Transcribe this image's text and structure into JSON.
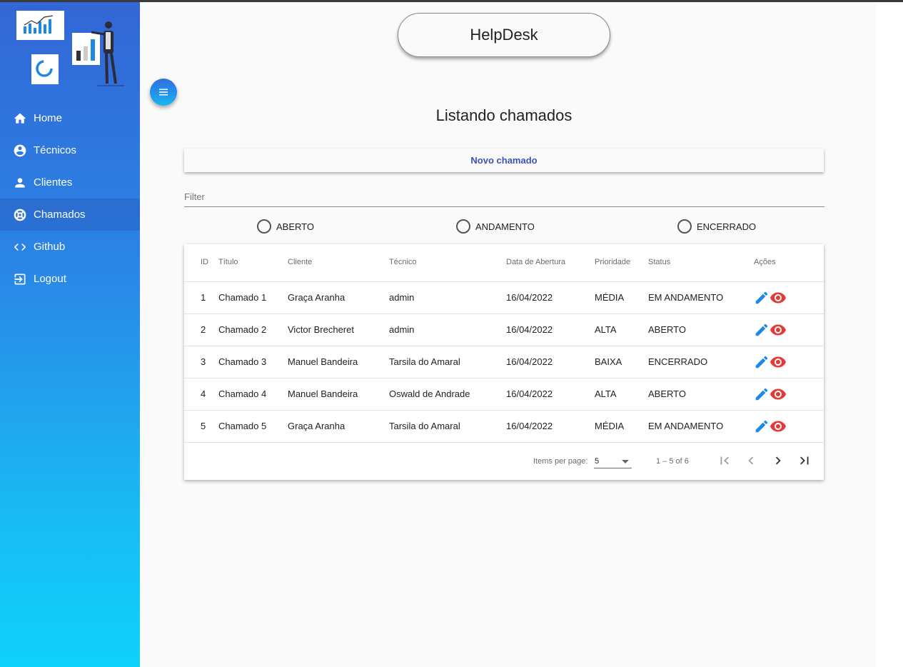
{
  "app": {
    "brand": "HelpDesk",
    "menu_icon": "menu-icon"
  },
  "sidebar": {
    "items": [
      {
        "label": "Home",
        "icon": "home-icon",
        "active": false
      },
      {
        "label": "Técnicos",
        "icon": "account-circle-icon",
        "active": false
      },
      {
        "label": "Clientes",
        "icon": "person-icon",
        "active": false
      },
      {
        "label": "Chamados",
        "icon": "support-icon",
        "active": true
      },
      {
        "label": "Github",
        "icon": "code-icon",
        "active": false
      },
      {
        "label": "Logout",
        "icon": "logout-icon",
        "active": false
      }
    ]
  },
  "main": {
    "title": "Listando chamados",
    "new_button": "Novo chamado",
    "filter_placeholder": "Filter",
    "status_filters": [
      "ABERTO",
      "ANDAMENTO",
      "ENCERRADO"
    ],
    "table": {
      "headers": [
        "ID",
        "Título",
        "Cliente",
        "Técnico",
        "Data de Abertura",
        "Prioridade",
        "Status",
        "Ações"
      ],
      "rows": [
        {
          "id": "1",
          "titulo": "Chamado 1",
          "cliente": "Graça Aranha",
          "tecnico": "admin",
          "data": "16/04/2022",
          "prioridade": "MÉDIA",
          "status": "EM ANDAMENTO"
        },
        {
          "id": "2",
          "titulo": "Chamado 2",
          "cliente": "Victor Brecheret",
          "tecnico": "admin",
          "data": "16/04/2022",
          "prioridade": "ALTA",
          "status": "ABERTO"
        },
        {
          "id": "3",
          "titulo": "Chamado 3",
          "cliente": "Manuel Bandeira",
          "tecnico": "Tarsila do Amaral",
          "data": "16/04/2022",
          "prioridade": "BAIXA",
          "status": "ENCERRADO"
        },
        {
          "id": "4",
          "titulo": "Chamado 4",
          "cliente": "Manuel Bandeira",
          "tecnico": "Oswald de Andrade",
          "data": "16/04/2022",
          "prioridade": "ALTA",
          "status": "ABERTO"
        },
        {
          "id": "5",
          "titulo": "Chamado 5",
          "cliente": "Graça Aranha",
          "tecnico": "Tarsila do Amaral",
          "data": "16/04/2022",
          "prioridade": "MÉDIA",
          "status": "EM ANDAMENTO"
        }
      ],
      "action_icons": [
        "edit-icon",
        "view-icon"
      ]
    },
    "paginator": {
      "items_per_page_label": "Items per page:",
      "page_size": "5",
      "range": "1 – 5 of 6"
    }
  },
  "colors": {
    "accent": "#3f51b5",
    "edit_icon": "#1e88e5",
    "view_icon": "#e53935",
    "sidebar_top": "#3366d6",
    "sidebar_bottom": "#0fd2fb"
  }
}
